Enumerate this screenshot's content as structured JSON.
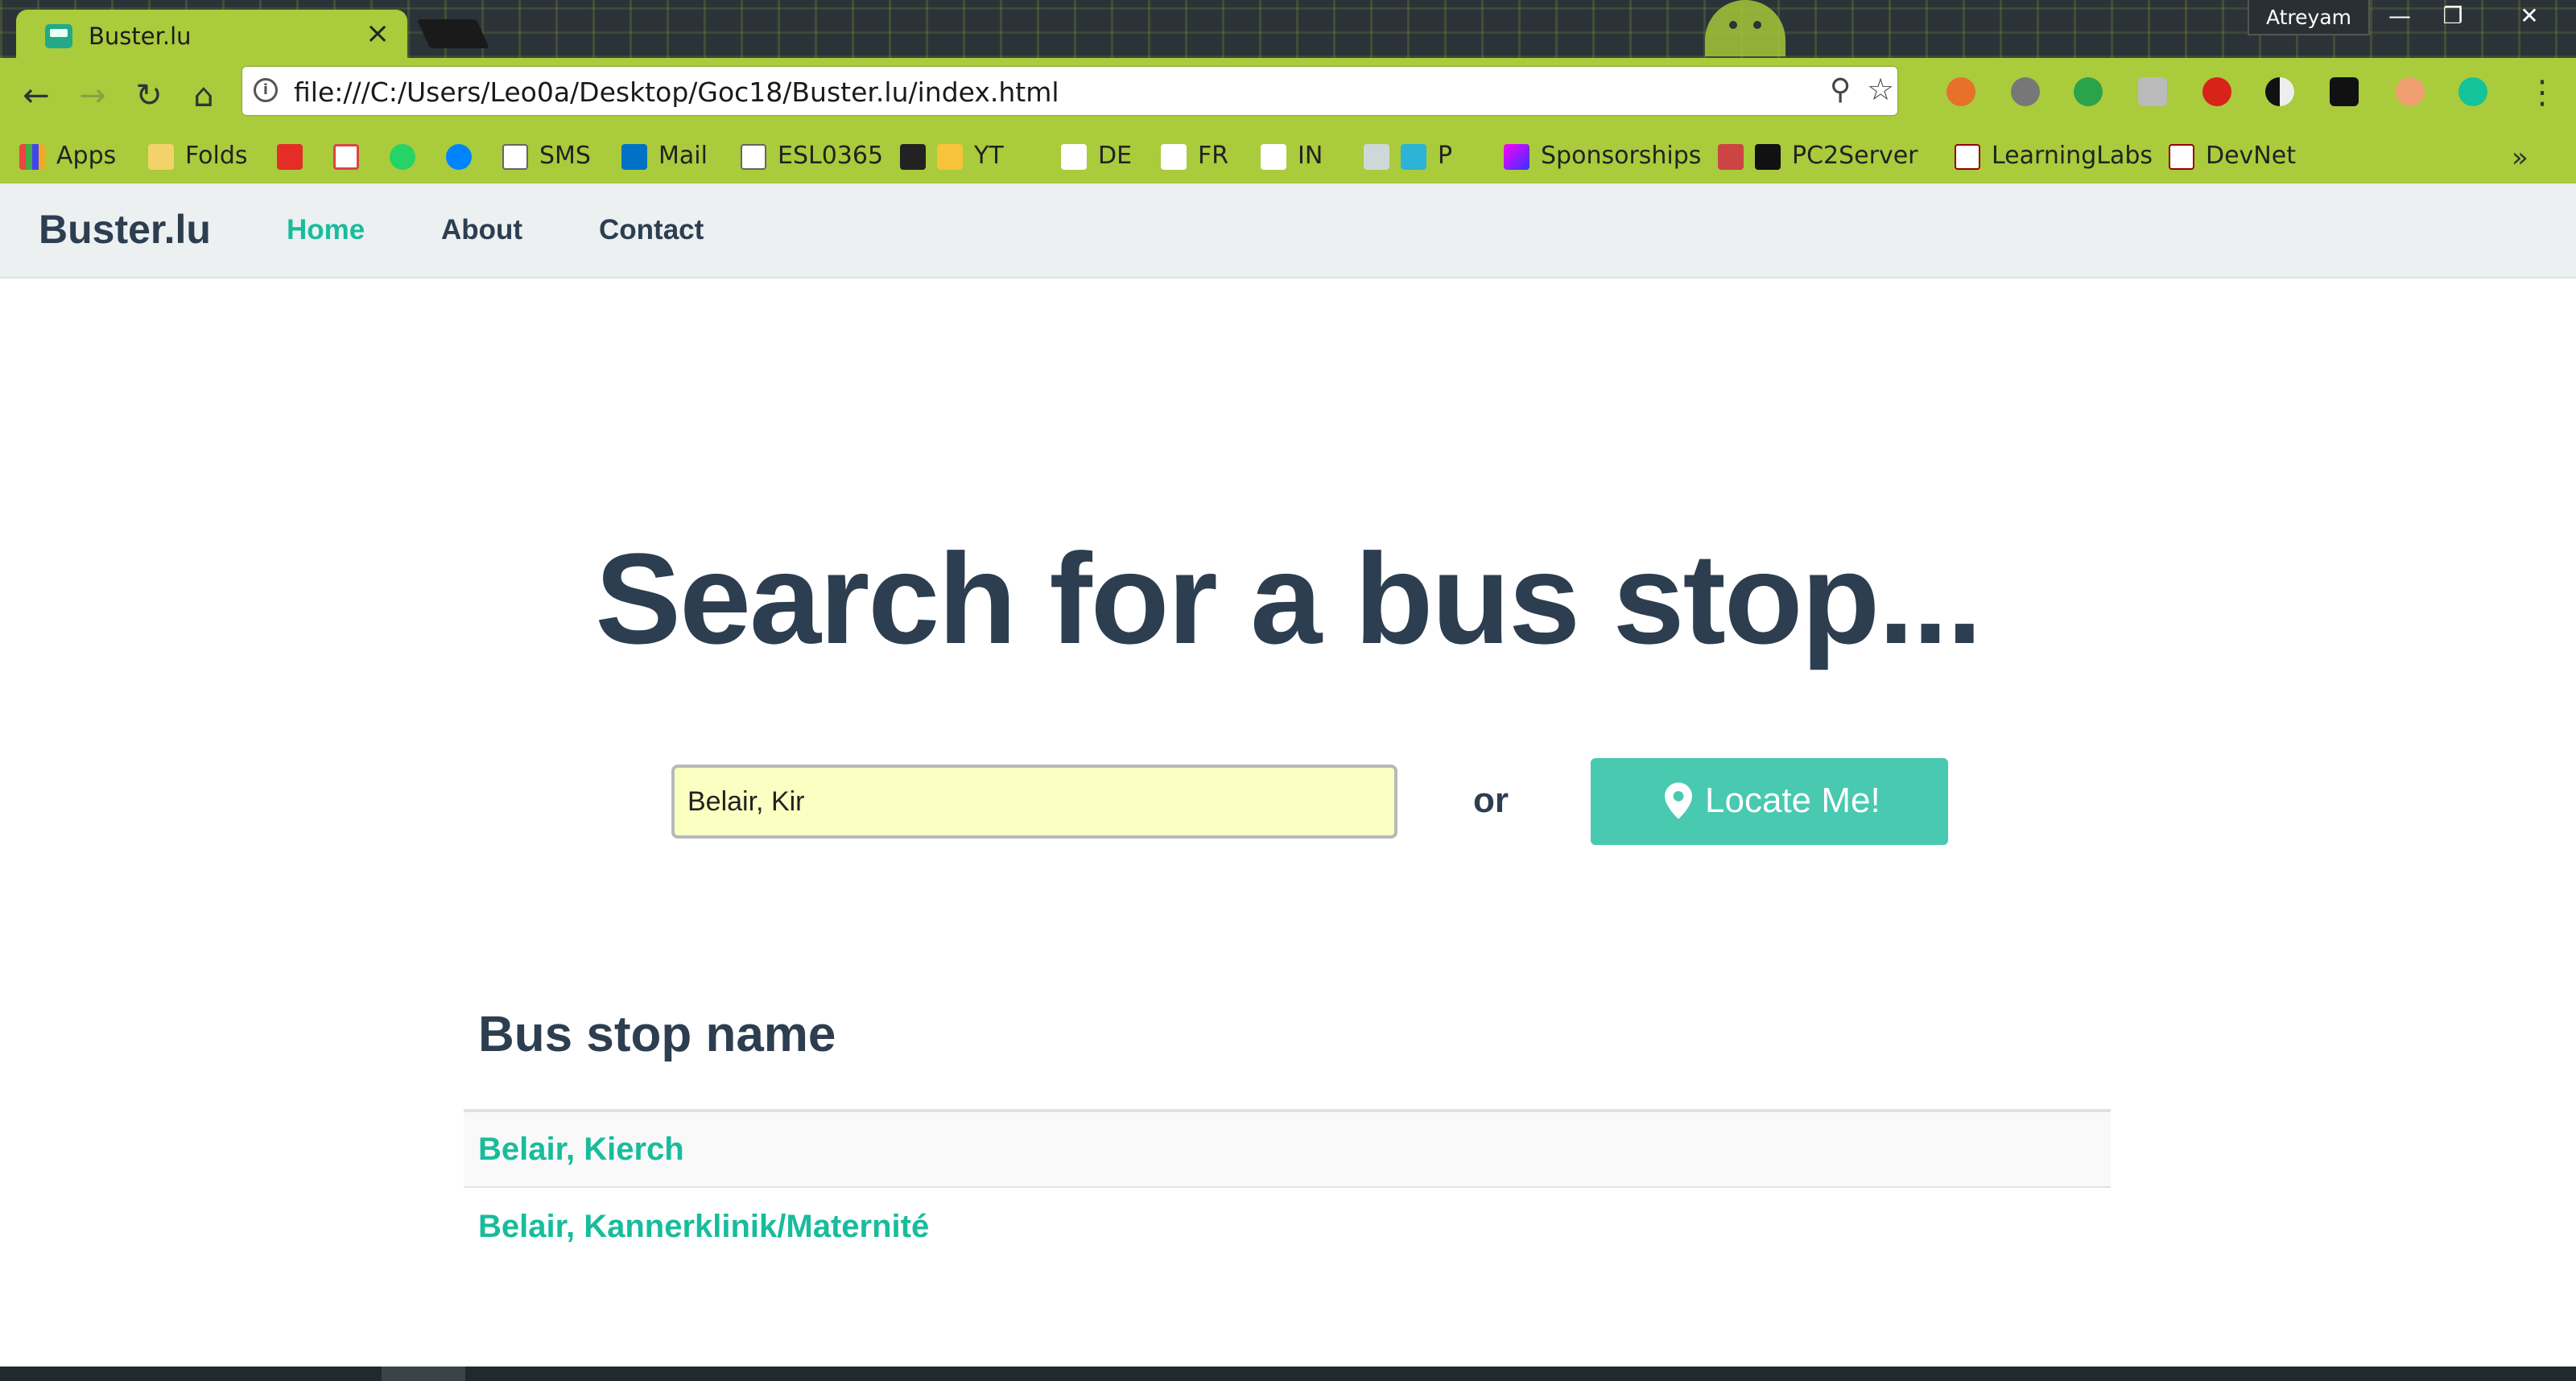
{
  "browser": {
    "tab_title": "Buster.lu",
    "tab_close": "×",
    "profile_name": "Atreyam",
    "url": "file:///C:/Users/Leo0a/Desktop/Goc18/Buster.lu/index.html",
    "bookmarks": [
      "Apps",
      "Folds",
      "SMS",
      "Mail",
      "ESL0365",
      "YT",
      "DE",
      "FR",
      "IN",
      "P",
      "Sponsorships",
      "PC2Server",
      "LearningLabs",
      "DevNet"
    ],
    "overflow": "»"
  },
  "site": {
    "brand": "Buster.lu",
    "nav": {
      "home": "Home",
      "about": "About",
      "contact": "Contact"
    }
  },
  "main": {
    "heading": "Search for a bus stop...",
    "search_value": "Belair, Kir",
    "or": "or",
    "locate_button": "Locate Me!",
    "table_header": "Bus stop name",
    "results": [
      "Belair, Kierch",
      "Belair, Kannerklinik/Maternité"
    ]
  },
  "colors": {
    "accent": "#18bc9c",
    "primary": "#2c3e50",
    "button": "#48c9b0",
    "chrome": "#a9cb3c"
  }
}
